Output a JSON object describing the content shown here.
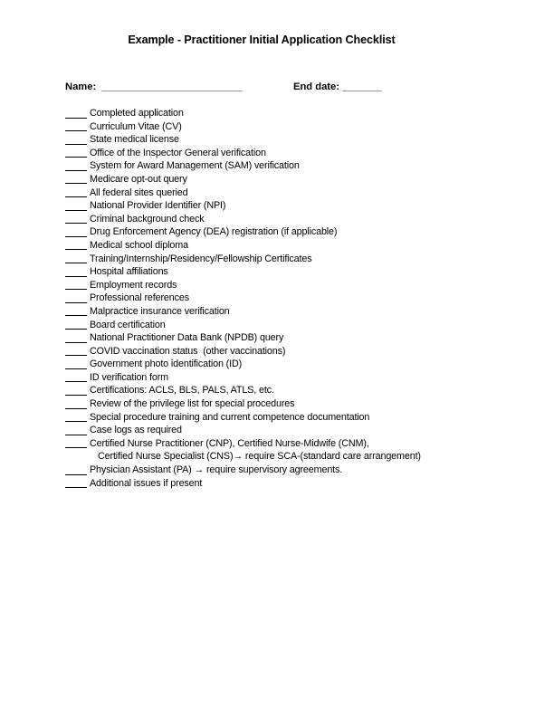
{
  "document": {
    "title": "Example - Practitioner Initial Application Checklist",
    "fields": {
      "name_label": "Name:",
      "name_blank": "_________________________",
      "end_date_label": "End date:",
      "end_date_blank": "_______"
    },
    "checklist": [
      {
        "label": "Completed application"
      },
      {
        "label": "Curriculum Vitae (CV)"
      },
      {
        "label": "State medical license"
      },
      {
        "label": "Office of the Inspector General verification"
      },
      {
        "label": "System for Award Management (SAM) verification"
      },
      {
        "label": "Medicare opt-out query"
      },
      {
        "label": "All federal sites queried"
      },
      {
        "label": "National Provider Identifier (NPI)"
      },
      {
        "label": "Criminal background check"
      },
      {
        "label": "Drug Enforcement Agency (DEA) registration (if applicable)"
      },
      {
        "label": "Medical school diploma"
      },
      {
        "label": "Training/Internship/Residency/Fellowship Certificates"
      },
      {
        "label": "Hospital affiliations"
      },
      {
        "label": "Employment records"
      },
      {
        "label": "Professional references"
      },
      {
        "label": "Malpractice insurance verification"
      },
      {
        "label": "Board certification"
      },
      {
        "label": "National Practitioner Data Bank (NPDB) query"
      },
      {
        "label": "COVID vaccination status  (other vaccinations)"
      },
      {
        "label": "Government photo identification (ID)"
      },
      {
        "label": "ID verification form"
      },
      {
        "label": "Certifications: ACLS, BLS, PALS, ATLS, etc."
      },
      {
        "label": "Review of the privilege list for special procedures"
      },
      {
        "label": "Special procedure training and current competence documentation"
      },
      {
        "label": "Case logs as required"
      },
      {
        "label": "Certified Nurse Practitioner (CNP), Certified Nurse-Midwife (CNM),",
        "continuation": "Certified Nurse Specialist (CNS)→ require SCA-(standard care arrangement)"
      },
      {
        "label": "Physician Assistant (PA) → require supervisory agreements."
      },
      {
        "label": "Additional issues if present"
      }
    ]
  }
}
